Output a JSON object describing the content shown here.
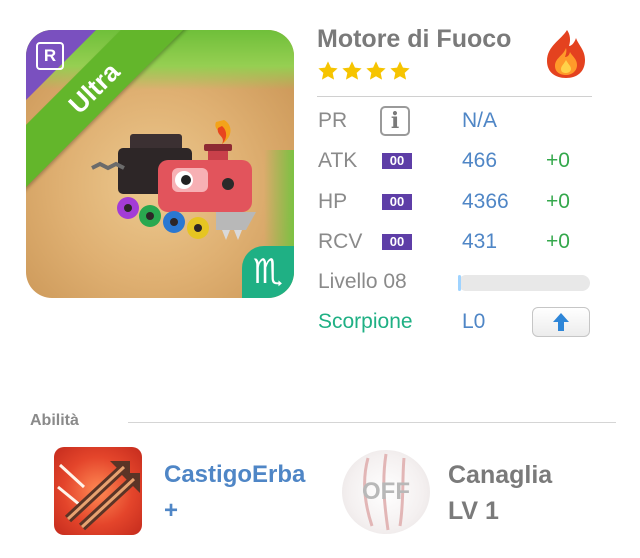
{
  "card": {
    "rarity_letter": "R",
    "tier": "Ultra",
    "name": "Motore di Fuoco",
    "stars": 4,
    "element_icon": "fire-icon",
    "sign_symbol": "♏",
    "colors": {
      "tier_ribbon": "#63b62b",
      "corner": "#7a50bf",
      "sign_badge": "#1fb084"
    }
  },
  "stats": {
    "pr": {
      "label": "PR",
      "value": "N/A",
      "icon": "info-icon"
    },
    "atk": {
      "label": "ATK",
      "badge": "00",
      "value": "466",
      "bonus": "+0"
    },
    "hp": {
      "label": "HP",
      "badge": "00",
      "value": "4366",
      "bonus": "+0"
    },
    "rcv": {
      "label": "RCV",
      "badge": "00",
      "value": "431",
      "bonus": "+0"
    },
    "level": {
      "label": "Livello 08",
      "progress": 0.02
    },
    "sign": {
      "label": "Scorpione",
      "value": "L0",
      "button_icon": "arrow-up-icon"
    }
  },
  "abilities": {
    "section_title": "Abilità",
    "active": {
      "name": "CastigoErba",
      "suffix": "+"
    },
    "passive": {
      "status": "OFF",
      "name": "Canaglia",
      "level": "LV 1"
    }
  }
}
